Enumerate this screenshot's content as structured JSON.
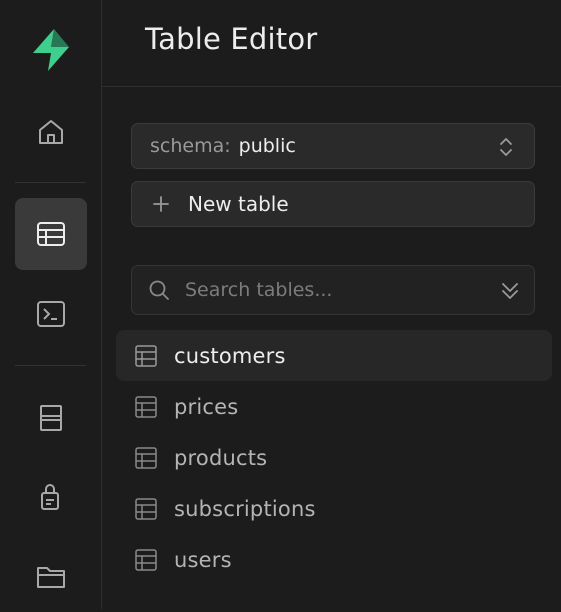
{
  "header": {
    "title": "Table Editor"
  },
  "nav": {
    "items": [
      {
        "name": "home",
        "icon": "home-icon",
        "active": false
      },
      {
        "name": "table-editor",
        "icon": "table-icon",
        "active": true
      },
      {
        "name": "sql-editor",
        "icon": "terminal-icon",
        "active": false
      },
      {
        "name": "database",
        "icon": "database-icon",
        "active": false
      },
      {
        "name": "auth",
        "icon": "lock-icon",
        "active": false
      },
      {
        "name": "storage",
        "icon": "folder-icon",
        "active": false
      }
    ]
  },
  "schema": {
    "prefix": "schema:",
    "value": "public"
  },
  "toolbar": {
    "new_table_label": "New table"
  },
  "search": {
    "placeholder": "Search tables..."
  },
  "tables": {
    "items": [
      {
        "label": "customers",
        "active": true
      },
      {
        "label": "prices",
        "active": false
      },
      {
        "label": "products",
        "active": false
      },
      {
        "label": "subscriptions",
        "active": false
      },
      {
        "label": "users",
        "active": false
      }
    ]
  },
  "colors": {
    "brand": "#3ecf8e",
    "background": "#1c1c1c",
    "active_nav": "#3a3a3a",
    "text": "#ededed",
    "muted_text": "#9a9a9a"
  }
}
